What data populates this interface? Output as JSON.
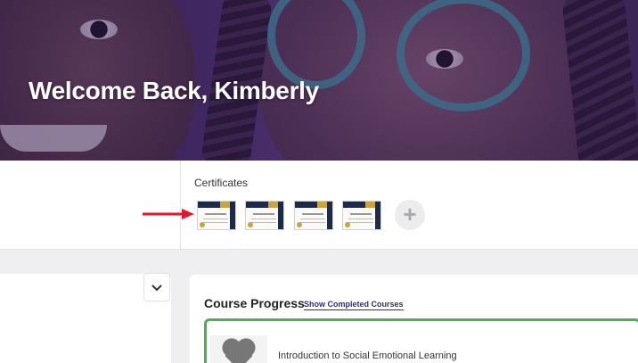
{
  "hero": {
    "title": "Welcome Back, Kimberly"
  },
  "certificates": {
    "title": "Certificates",
    "items": [
      {
        "name": "certificate-1"
      },
      {
        "name": "certificate-2"
      },
      {
        "name": "certificate-3"
      },
      {
        "name": "certificate-4"
      }
    ],
    "add_icon": "plus-icon",
    "add_symbol": "+",
    "arrow_color": "#e0182d"
  },
  "sidebar_panel": {
    "collapse_icon": "chevron-down-icon",
    "collapse_symbol": "⌄"
  },
  "course_progress": {
    "title": "Course Progress",
    "show_completed_label": "Show Completed Courses",
    "progress_color": "#4caf50",
    "courses": [
      {
        "name": "Introduction to Social Emotional Learning",
        "thumbnail_icon": "heart-icon"
      }
    ]
  }
}
